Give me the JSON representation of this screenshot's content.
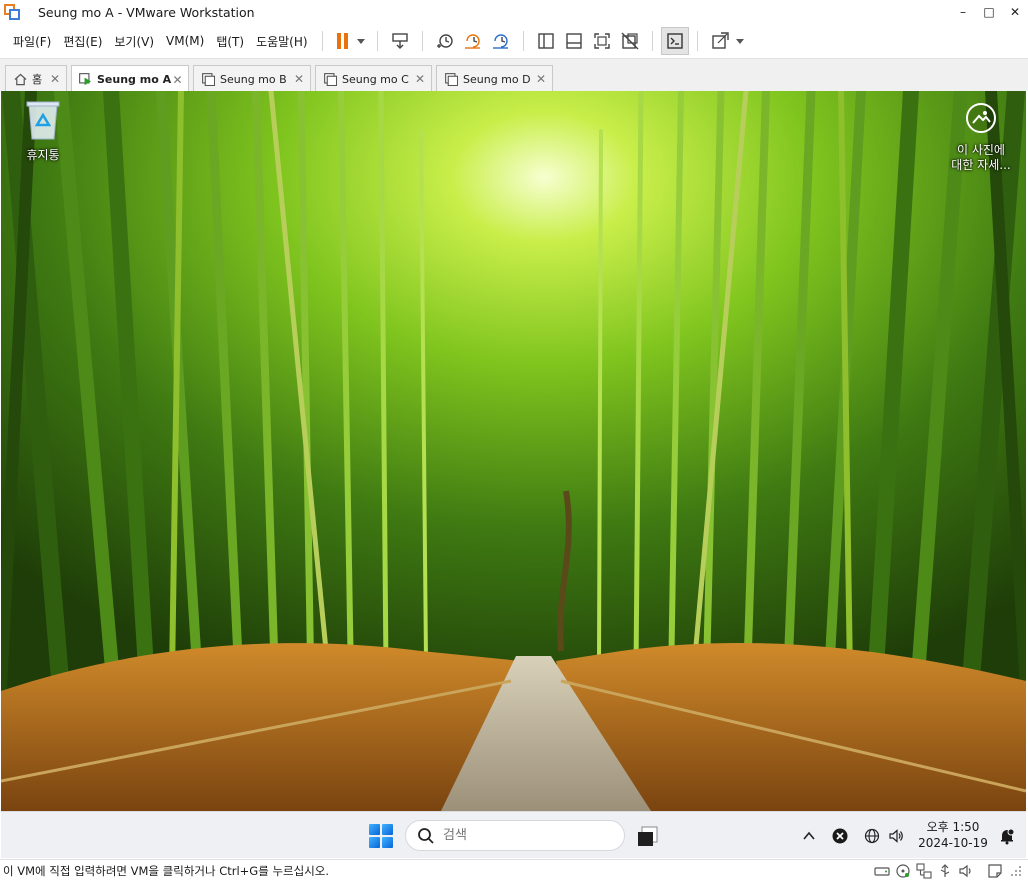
{
  "window": {
    "title": "Seung mo A - VMware Workstation",
    "min_glyph": "–",
    "max_glyph": "□",
    "close_glyph": "✕"
  },
  "menu": {
    "items": [
      "파일(F)",
      "편집(E)",
      "보기(V)",
      "VM(M)",
      "탭(T)",
      "도움말(H)"
    ]
  },
  "tabs": [
    {
      "label": "홈",
      "icon": "home-icon",
      "active": false
    },
    {
      "label": "Seung mo A",
      "icon": "vm-running-icon",
      "active": true
    },
    {
      "label": "Seung mo B",
      "icon": "vm-icon",
      "active": false
    },
    {
      "label": "Seung mo C",
      "icon": "vm-icon",
      "active": false
    },
    {
      "label": "Seung mo D",
      "icon": "vm-icon",
      "active": false
    }
  ],
  "tab_close_glyph": "✕",
  "desktop": {
    "recycle_label": "휴지통",
    "spotlight_line1": "이 사진에",
    "spotlight_line2": "대한 자세..."
  },
  "taskbar": {
    "search_placeholder": "검색",
    "clock_time": "오후 1:50",
    "clock_date": "2024-10-19"
  },
  "status": {
    "message": "이 VM에 직접 입력하려면 VM을 클릭하거나 Ctrl+G를 누르십시오."
  },
  "colors": {
    "accent_orange": "#e8730c",
    "vmware_blue": "#3d7dd8"
  }
}
